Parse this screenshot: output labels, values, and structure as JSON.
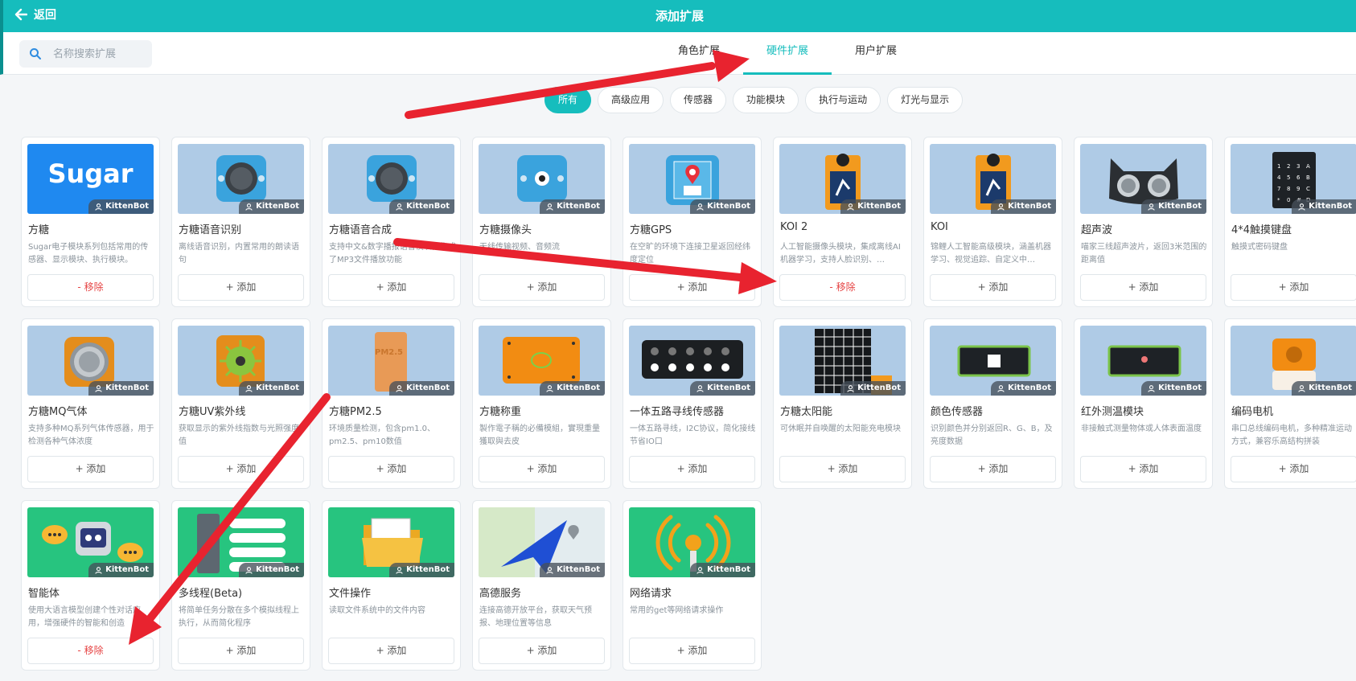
{
  "header": {
    "back_label": "返回",
    "title": "添加扩展"
  },
  "search": {
    "placeholder": "名称搜索扩展"
  },
  "tabs": [
    {
      "label": "角色扩展",
      "active": false
    },
    {
      "label": "硬件扩展",
      "active": true
    },
    {
      "label": "用户扩展",
      "active": false
    }
  ],
  "filters": [
    {
      "label": "所有",
      "active": true
    },
    {
      "label": "高级应用",
      "active": false
    },
    {
      "label": "传感器",
      "active": false
    },
    {
      "label": "功能模块",
      "active": false
    },
    {
      "label": "执行与运动",
      "active": false
    },
    {
      "label": "灯光与显示",
      "active": false
    }
  ],
  "badge_text": "KittenBot",
  "cards": [
    {
      "name": "方糖",
      "desc": "Sugar电子模块系列包括常用的传感器、显示模块、执行模块。",
      "button": "- 移除",
      "thumb_text": "Sugar",
      "icon": "sugar-logo"
    },
    {
      "name": "方糖语音识别",
      "desc": "离线语音识别，内置常用的朗读语句",
      "button": "+ 添加",
      "icon": "speaker-module"
    },
    {
      "name": "方糖语音合成",
      "desc": "支持中文&数字播报语音模块，集成了MP3文件播放功能",
      "button": "+ 添加",
      "icon": "speaker-module"
    },
    {
      "name": "方糖摄像头",
      "desc": "无线传输视频、音频流",
      "button": "+ 添加",
      "icon": "camera-module"
    },
    {
      "name": "方糖GPS",
      "desc": "在空旷的环境下连接卫星返回经纬度定位",
      "button": "+ 添加",
      "icon": "gps-module"
    },
    {
      "name": "KOI 2",
      "desc": "人工智能摄像头模块，集成离线AI机器学习，支持人脸识别、…",
      "button": "- 移除",
      "icon": "koi-camera"
    },
    {
      "name": "KOI",
      "desc": "锦鲤人工智能高级模块，涵盖机器学习、视觉追踪、自定义中…",
      "button": "+ 添加",
      "icon": "koi-camera"
    },
    {
      "name": "超声波",
      "desc": "喵家三线超声波片，返回3米范围的距离值",
      "button": "+ 添加",
      "icon": "ultrasonic-sensor"
    },
    {
      "name": "4*4触摸键盘",
      "desc": "触摸式密码键盘",
      "button": "+ 添加",
      "icon": "keypad"
    },
    {
      "name": "方糖MQ气体",
      "desc": "支持多种MQ系列气体传感器，用于检测各种气体浓度",
      "button": "+ 添加",
      "icon": "gas-sensor"
    },
    {
      "name": "方糖UV紫外线",
      "desc": "获取显示的紫外线指数与光照强度值",
      "button": "+ 添加",
      "icon": "uv-sensor"
    },
    {
      "name": "方糖PM2.5",
      "desc": "环境质量检测，包含pm1.0、pm2.5、pm10数值",
      "button": "+ 添加",
      "thumb_text": "PM2.5",
      "icon": "pm25-sensor"
    },
    {
      "name": "方糖称重",
      "desc": "製作電子稱的必備模組，實現重量獲取與去皮",
      "button": "+ 添加",
      "icon": "weight-sensor"
    },
    {
      "name": "一体五路寻线传感器",
      "desc": "一体五路寻线，I2C协议，简化接线节省IO口",
      "button": "+ 添加",
      "icon": "line-tracker"
    },
    {
      "name": "方糖太阳能",
      "desc": "可休眠并自唤醒的太阳能充电模块",
      "button": "+ 添加",
      "icon": "solar-panel"
    },
    {
      "name": "颜色传感器",
      "desc": "识别颜色并分别返回R、G、B，及亮度数据",
      "button": "+ 添加",
      "icon": "color-sensor"
    },
    {
      "name": "红外测温模块",
      "desc": "非接触式测量物体或人体表面温度",
      "button": "+ 添加",
      "icon": "ir-thermometer"
    },
    {
      "name": "编码电机",
      "desc": "串口总线编码电机，多种精准运动方式，兼容乐高结构拼装",
      "button": "+ 添加",
      "icon": "encoder-motor"
    },
    {
      "name": "智能体",
      "desc": "使用大语言模型创建个性对话应用，增强硬件的智能和创造",
      "button": "- 移除",
      "icon": "robot-agent"
    },
    {
      "name": "多线程(Beta)",
      "desc": "将简单任务分散在多个模拟线程上执行，从而简化程序",
      "button": "+ 添加",
      "icon": "threads"
    },
    {
      "name": "文件操作",
      "desc": "读取文件系统中的文件内容",
      "button": "+ 添加",
      "icon": "folder"
    },
    {
      "name": "高德服务",
      "desc": "连接高德开放平台，获取天气预报、地理位置等信息",
      "button": "+ 添加",
      "icon": "map-plane"
    },
    {
      "name": "网络请求",
      "desc": "常用的get等网络请求操作",
      "button": "+ 添加",
      "icon": "network-request"
    }
  ],
  "colors": {
    "accent": "#16bdbd",
    "remove": "#e64545",
    "thumb_bg": "#afcbe6",
    "thumb_green": "#27c47f",
    "arrow": "#e8232f"
  }
}
